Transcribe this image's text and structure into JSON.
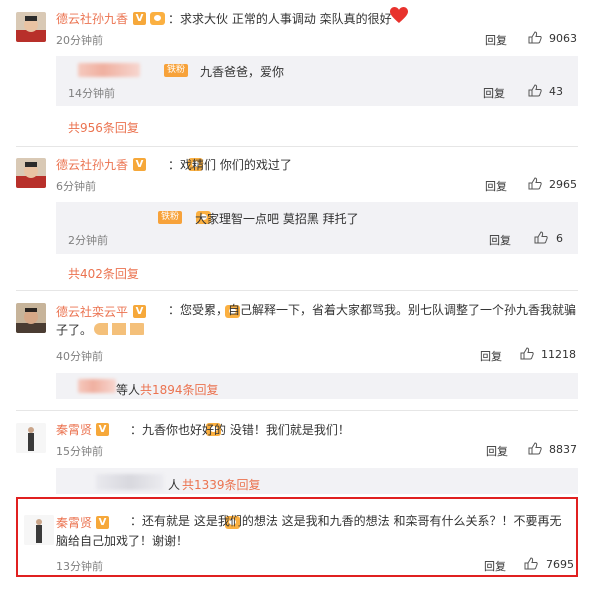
{
  "colors": {
    "name": "#eb7350",
    "link": "#eb7350",
    "highlight": "#e02020",
    "muted": "#808080"
  },
  "actions": {
    "reply": "回复"
  },
  "comments": [
    {
      "name": "德云社孙九香",
      "text": "：求求大伙 正常的人事调动 栾队真的很好",
      "emoji": "heart",
      "time": "20分钟前",
      "likes": "9063",
      "sub": {
        "text": "九香爸爸，爱你",
        "time": "14分钟前",
        "likes": "43",
        "badge": "铁粉"
      },
      "more": "共956条回复"
    },
    {
      "name": "德云社孙九香",
      "text": "：戏精们 你们的戏过了",
      "time": "6分钟前",
      "likes": "2965",
      "sub": {
        "text": "大家理智一点吧 莫招黑 拜托了",
        "time": "2分钟前",
        "likes": "6",
        "badge": "铁粉"
      },
      "more": "共402条回复"
    },
    {
      "name": "德云社栾云平",
      "text": "：您受累，自己解释一下，省着大家都骂我。别七队调整了一个孙九香我就骗子了。",
      "time": "40分钟前",
      "likes": "11218",
      "more_prefix": "等人",
      "more": "共1894条回复"
    },
    {
      "name": "秦霄贤",
      "text": "：九香你也好好的  没错！我们就是我们！",
      "time": "15分钟前",
      "likes": "8837",
      "more_prefix": "人",
      "more": "共1339条回复"
    },
    {
      "name": "秦霄贤",
      "text": "：还有就是  这是我们的想法    这是我和九香的想法    和栾哥有什么关系？！不要再无脑给自己加戏了！谢谢！",
      "time": "13分钟前",
      "likes": "7695"
    }
  ]
}
